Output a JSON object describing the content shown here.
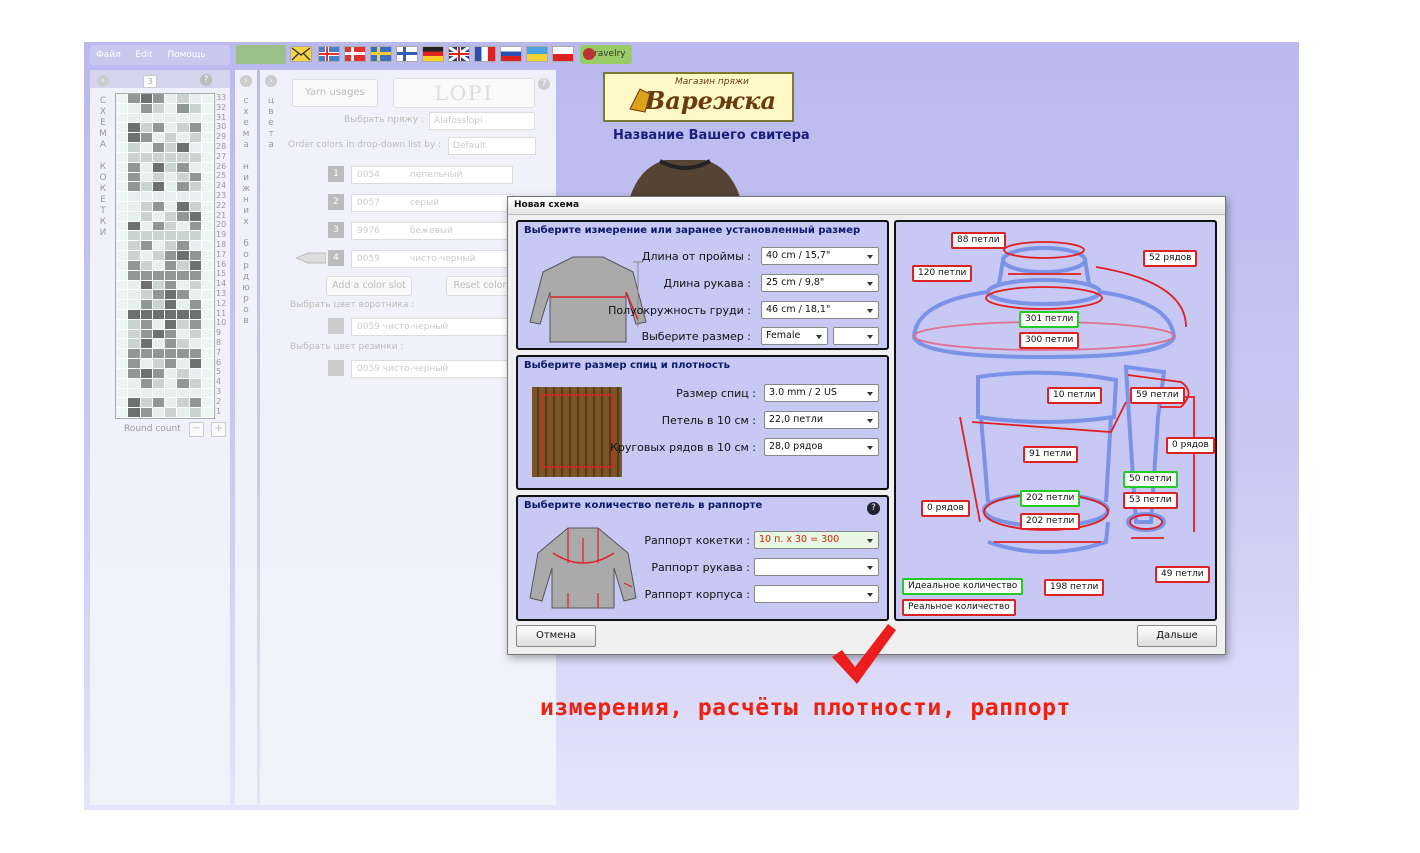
{
  "menu": {
    "file": "Файл",
    "edit": "Edit",
    "help": "Помощь"
  },
  "ravelry": "ravelry",
  "left_panel": {
    "vertical_label": "СХЕМА КОКЕТКИ",
    "round_count_label": "Round count",
    "rows": [
      "33",
      "32",
      "31",
      "30",
      "29",
      "28",
      "27",
      "26",
      "25",
      "24",
      "23",
      "22",
      "21",
      "20",
      "19",
      "18",
      "17",
      "16",
      "15",
      "14",
      "13",
      "12",
      "11",
      "10",
      "9",
      "8",
      "7",
      "6",
      "5",
      "4",
      "3",
      "2",
      "1"
    ],
    "chart_code": "3"
  },
  "mid_label": "схема нижних бордюров",
  "colors_label": "цвета",
  "yarn_panel": {
    "yarn_usages": "Yarn usages",
    "brand": "LOPI",
    "choose_yarn_label": "Выбрать пряжу :",
    "choose_yarn_value": "Álafosslopi",
    "order_label": "Order colors in drop-down list by :",
    "order_value": "Default",
    "slots": [
      {
        "num": "1",
        "code": "0054",
        "name": "пепельный"
      },
      {
        "num": "2",
        "code": "0057",
        "name": "серый"
      },
      {
        "num": "3",
        "code": "9976",
        "name": "бежевый"
      },
      {
        "num": "4",
        "code": "0059",
        "name": "чисто-черный"
      }
    ],
    "add_slot": "Add a color slot",
    "reset": "Reset color",
    "collar_label": "Выбрать цвет воротника :",
    "collar_value": "0059 чисто-черный",
    "rib_label": "Выбрать цвет резинки :",
    "rib_value": "0059 чисто-черный"
  },
  "logo": {
    "small": "Магазин пряжи",
    "big": "Варежка"
  },
  "sweater_name": "Название Вашего свитера",
  "dialog": {
    "title": "Новая схема",
    "s1": {
      "title": "Выберите измерение или заранее установленный размер",
      "length_label": "Длина  от проймы :",
      "length_value": "40 cm / 15,7\"",
      "sleeve_label": "Длина рукава :",
      "sleeve_value": "25 cm / 9,8\"",
      "chest_label": "Полуокружность груди :",
      "chest_value": "46 cm / 18,1\"",
      "size_label": "Выберите размер :",
      "size_value": "Female",
      "size_value2": ""
    },
    "s2": {
      "title": "Выберите размер спиц и плотность",
      "needle_label": "Размер спиц :",
      "needle_value": "3.0 mm / 2 US",
      "stitches_label": "Петель в 10 см :",
      "stitches_value": "22,0 петли",
      "rows_label": "Круговых рядов в 10 см :",
      "rows_value": "28,0 рядов"
    },
    "s3": {
      "title": "Выберите количество петель в раппорте",
      "yoke_label": "Раппорт кокетки :",
      "yoke_value": "10 п.    x  30 = 300",
      "sleeve_label": "Раппорт рукава :",
      "sleeve_value": "",
      "body_label": "Раппорт корпуса :",
      "body_value": ""
    },
    "diagram": {
      "t88": "88 петли",
      "t120": "120 петли",
      "t52": "52 рядов",
      "t301": "301 петли",
      "t300": "300 петли",
      "t10": "10 петли",
      "t59": "59 петли",
      "t0a": "0 рядов",
      "t91": "91 петли",
      "t50": "50 петли",
      "t53": "53 петли",
      "t0b": "0 рядов",
      "t202a": "202 петли",
      "t202b": "202 петли",
      "t49": "49 петли",
      "t198": "198 петли",
      "ideal": "Идеальное количество",
      "real": "Реальное количество"
    },
    "cancel": "Отмена",
    "next": "Дальше"
  },
  "caption": "измерения, расчёты плотности, раппорт"
}
